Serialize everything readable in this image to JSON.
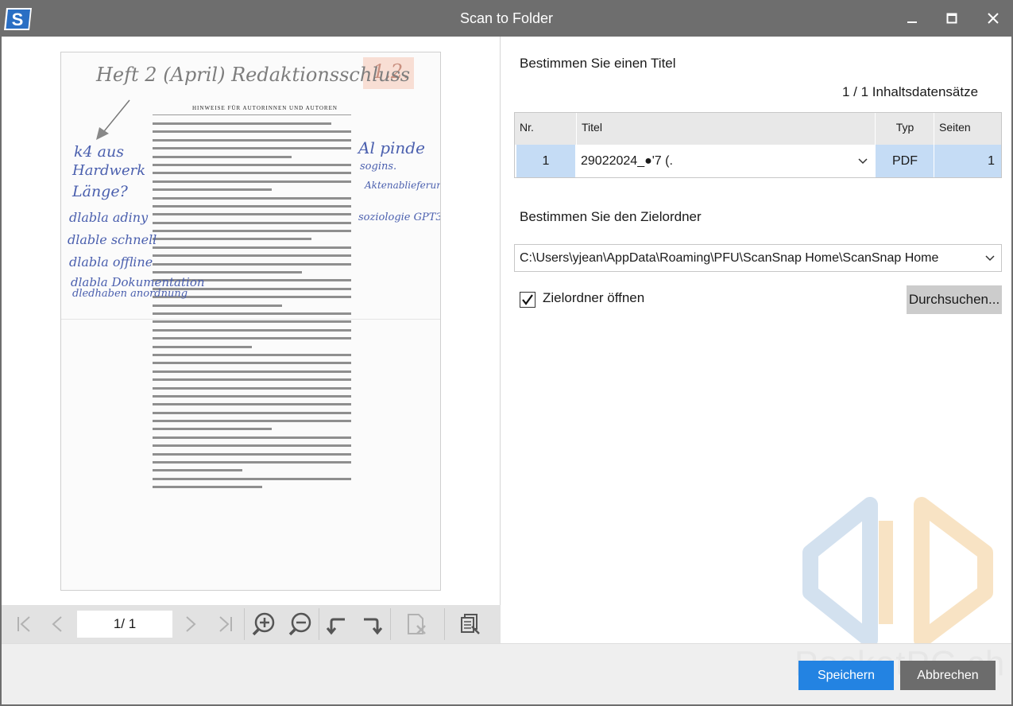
{
  "window": {
    "title": "Scan to Folder",
    "logo_letter": "S",
    "controls": [
      "minimize-icon",
      "maximize-icon",
      "close-icon"
    ]
  },
  "preview": {
    "handwriting": {
      "top_line": "Heft 2 (April) Redaktionsschluss",
      "sticky_note": "1.2.",
      "left_1": "k4 aus",
      "left_2": "Hardwerk",
      "left_3": "Länge?",
      "left_4": "dlabla adiny",
      "left_5": "dlable schnell",
      "left_6": "dlabla offline",
      "left_7": "dlabla Dokumentation",
      "left_8": "dledhaben anordnung",
      "right_1": "Al pinde",
      "right_2": "sogins.",
      "right_3": "Aktenablieferung",
      "right_4": "soziologie GPT3"
    },
    "doc_heading": "HINWEISE FÜR AUTORINNEN UND AUTOREN"
  },
  "toolbar": {
    "page_indicator": "1/   1",
    "icons": [
      "first-page-icon",
      "prev-page-icon",
      "next-page-icon",
      "last-page-icon",
      "zoom-in-icon",
      "zoom-out-icon",
      "rotate-left-icon",
      "rotate-right-icon",
      "delete-page-icon",
      "page-list-icon"
    ]
  },
  "title_section": {
    "heading": "Bestimmen Sie einen Titel",
    "record_count": "1 /    1 Inhaltsdatensätze"
  },
  "table": {
    "headers": {
      "nr": "Nr.",
      "title": "Titel",
      "type": "Typ",
      "pages": "Seiten"
    },
    "rows": [
      {
        "nr": "1",
        "title": "29022024_●'7 (.",
        "type": "PDF",
        "pages": "1"
      }
    ]
  },
  "folder_section": {
    "heading": "Bestimmen Sie den Zielordner",
    "path": "C:\\Users\\yjean\\AppData\\Roaming\\PFU\\ScanSnap Home\\ScanSnap Home",
    "open_folder_label": "Zielordner öffnen",
    "open_folder_checked": true,
    "browse_label": "Durchsuchen..."
  },
  "watermark": {
    "text": "PocketPC.ch"
  },
  "footer": {
    "save_label": "Speichern",
    "cancel_label": "Abbrechen"
  },
  "colors": {
    "titlebar": "#6e6e6e",
    "accent": "#2383e2",
    "cell_highlight": "#c5dcf5",
    "cancel": "#6c6c6c"
  }
}
